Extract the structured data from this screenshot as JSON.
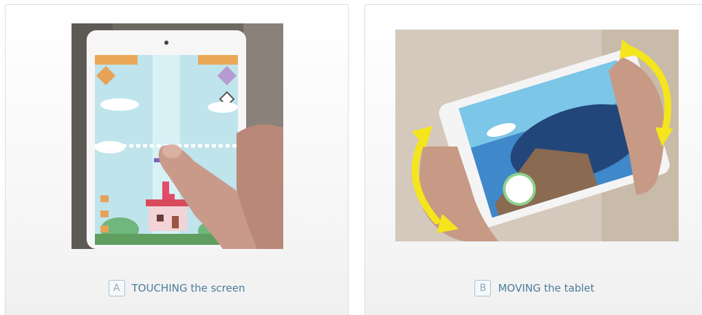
{
  "cards": [
    {
      "letter": "A",
      "caption": "TOUCHING the screen",
      "image_subject": "finger touching a tablet playing a tower game"
    },
    {
      "letter": "B",
      "caption": "MOVING the tablet",
      "image_subject": "hands tilting a tablet with yellow rotation arrows"
    }
  ],
  "colors": {
    "caption_text": "#4a7c98",
    "arrow": "#f5e51c",
    "game_sky": "#bfe4ec"
  },
  "icons": [
    "curved-double-arrow-icon",
    "curved-double-arrow-icon"
  ]
}
